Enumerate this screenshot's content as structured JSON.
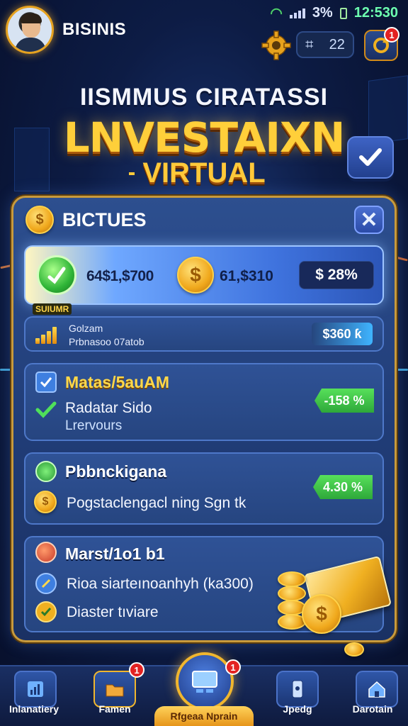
{
  "status_bar": {
    "battery": "3%",
    "time": "12:530"
  },
  "header": {
    "user_name": "BISINIS",
    "counter_value": "22",
    "counter_icon": "hash-icon",
    "alert_badge": "1"
  },
  "title": {
    "top": "IISMMUS CIRATASSI",
    "main": "LNVESTAIXN",
    "sub": "VIRTUAL"
  },
  "panel": {
    "title": "BICTUES",
    "close_label": "✕"
  },
  "featured": {
    "value1": "64$1,$700",
    "value2": "61,$310",
    "pill": "$ 28%",
    "tag": "SUIUMR"
  },
  "progress_row": {
    "label1": "Golzam",
    "label2": "Prbnasoo 07atob",
    "right": "$360 ƙ"
  },
  "section1": {
    "title": "Matas/5auAM",
    "line1": "Radatar Sido",
    "line2": "Lrervours",
    "tag": "-158 %"
  },
  "section2": {
    "title": "Pbbnckigana",
    "line1": "Pogstaclengacl ning Sgn tk",
    "tag": "4.30 %"
  },
  "section3": {
    "title": "Marst/1o1 b1",
    "line1": "Rioa siarteınoanhyh (ka300)",
    "line2": "Diaster tıviare"
  },
  "bottom_nav": {
    "items": [
      {
        "label": "Inlanatiery",
        "icon": "chart-doc-icon",
        "badge": ""
      },
      {
        "label": "Famen",
        "icon": "folder-icon",
        "badge": "1"
      },
      {
        "label": "Rfgeaa Nprain",
        "icon": "monitor-icon",
        "badge": "1"
      },
      {
        "label": "Jpedg",
        "icon": "phone-icon",
        "badge": ""
      },
      {
        "label": "Darotain",
        "icon": "home-icon",
        "badge": ""
      }
    ]
  },
  "colors": {
    "accent_gold": "#ffcf3a",
    "panel_blue": "#2d4f8f",
    "positive_green": "#2ea83a",
    "badge_red": "#e32222"
  }
}
